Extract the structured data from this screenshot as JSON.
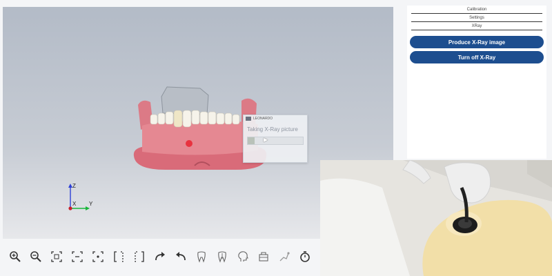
{
  "viewport": {
    "dialog": {
      "app_name": "LEONARDO",
      "message": "Taking X-Ray picture",
      "progress": 0.12
    },
    "axes": {
      "z": "Z",
      "x": "X",
      "y": "Y"
    }
  },
  "toolbar": {
    "tools": [
      "zoom-in-icon",
      "zoom-out-icon",
      "fit-all-icon",
      "fit-width-icon",
      "fit-center-icon",
      "view-left-icon",
      "view-right-icon",
      "redo-icon",
      "undo-icon",
      "tooth-icon",
      "tooth-root-icon",
      "head-profile-icon",
      "xray-device-icon",
      "scanner-arm-icon",
      "timer-icon"
    ]
  },
  "right_panel": {
    "menu": [
      "Calibration",
      "Settings",
      "XRay"
    ],
    "buttons": {
      "produce": "Produce X-Ray image",
      "turn_off": "Turn off X-Ray"
    }
  },
  "colors": {
    "primary_button": "#1d4e8f",
    "gum": "#e07a86",
    "viewport_top": "#b3bbc7"
  }
}
